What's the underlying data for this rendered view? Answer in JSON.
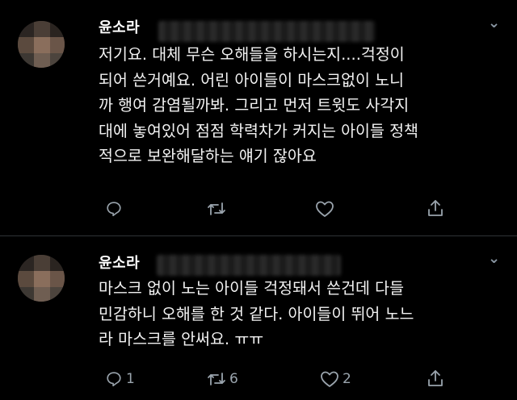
{
  "tweets": [
    {
      "author": "윤소라",
      "more_label": "⌄",
      "text": "저기요. 대체 무슨 오해들을 하시는지....걱정이\n되어 쓴거예요. 어린 아이들이 마스크없이 노니\n까 행여 감염될까봐. 그리고 먼저 트윗도 사각지\n대에 놓여있어 점점 학력차가 커지는 아이들 정책\n적으로 보완해달하는 얘기 잖아요",
      "actions": {
        "reply_count": "",
        "retweet_count": "",
        "like_count": ""
      }
    },
    {
      "author": "윤소라",
      "more_label": "⌄",
      "text": "마스크 없이 노는 아이들 걱정돼서 쓴건데 다들\n민감하니 오해를 한 것 같다. 아이들이 뛰어 노느\n라 마스크를 안써요. ㅠㅠ",
      "actions": {
        "reply_count": "1",
        "retweet_count": "6",
        "like_count": "2"
      }
    }
  ],
  "colors": {
    "background": "#000000",
    "text": "#f2f2f2",
    "icon": "#9aa4ad",
    "divider": "#2f3336"
  },
  "icons": [
    "reply-icon",
    "retweet-icon",
    "like-icon",
    "share-icon",
    "more-icon"
  ]
}
